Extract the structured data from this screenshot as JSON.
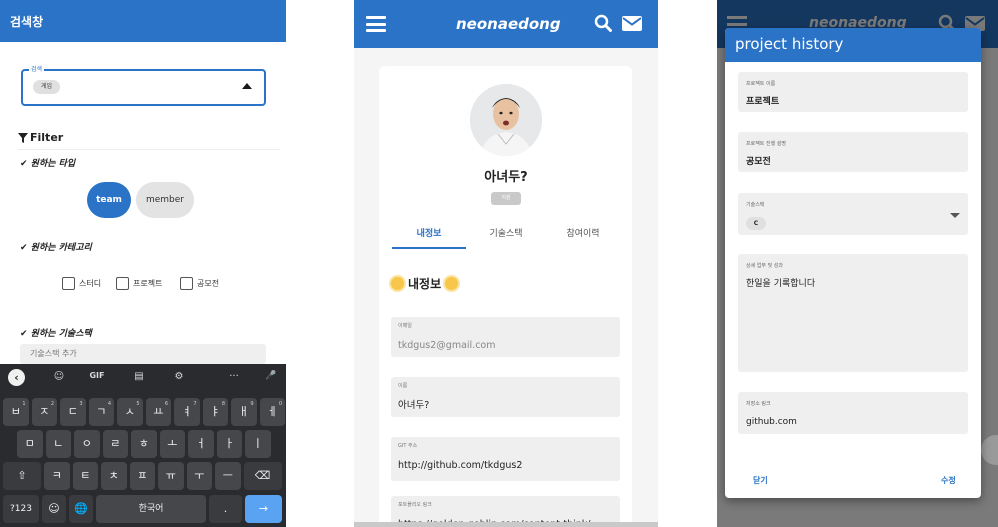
{
  "screen1": {
    "header_title": "검색창",
    "search_legend": "검색",
    "search_chip": "게임",
    "filter_label": "Filter",
    "type_label": "✔ 원하는 타입",
    "type_buttons": [
      "team",
      "member"
    ],
    "category_label": "✔ 원하는 카테고리",
    "categories": [
      "스터디",
      "프로젝트",
      "공모전"
    ],
    "stack_label": "✔ 원하는 기술스택",
    "stack_placeholder": "기술스택 추가",
    "keyboard": {
      "toolbar": [
        "☺",
        "GIF",
        "▤",
        "⚙",
        "···",
        "🎤"
      ],
      "row1": [
        {
          "k": "ㅂ",
          "n": "1"
        },
        {
          "k": "ㅈ",
          "n": "2"
        },
        {
          "k": "ㄷ",
          "n": "3"
        },
        {
          "k": "ㄱ",
          "n": "4"
        },
        {
          "k": "ㅅ",
          "n": "5"
        },
        {
          "k": "ㅛ",
          "n": "6"
        },
        {
          "k": "ㅕ",
          "n": "7"
        },
        {
          "k": "ㅑ",
          "n": "8"
        },
        {
          "k": "ㅐ",
          "n": "9"
        },
        {
          "k": "ㅔ",
          "n": "0"
        }
      ],
      "row2": [
        "ㅁ",
        "ㄴ",
        "ㅇ",
        "ㄹ",
        "ㅎ",
        "ㅗ",
        "ㅓ",
        "ㅏ",
        "ㅣ"
      ],
      "row3": [
        "⇧",
        "ㅋ",
        "ㅌ",
        "ㅊ",
        "ㅍ",
        "ㅠ",
        "ㅜ",
        "ㅡ",
        "⌫"
      ],
      "row4": [
        "?123",
        "☺",
        "🌐",
        "한국어",
        ".",
        "→"
      ]
    }
  },
  "screen2": {
    "app_title": "neonaedong",
    "user_name": "아녀두?",
    "badge": "지원",
    "tabs": [
      "내정보",
      "기술스택",
      "참여이력"
    ],
    "section_title": "내정보",
    "fields": [
      {
        "label": "이메일",
        "value": "tkdgus2@gmail.com",
        "muted": true
      },
      {
        "label": "이름",
        "value": "아녀두?"
      },
      {
        "label": "GIT 주소",
        "value": "http://github.com/tkdgus2"
      },
      {
        "label": "포트폴리오 링크",
        "value": "https://golden-goblin.com/content-think/"
      }
    ]
  },
  "screen3": {
    "app_title": "neonaedong",
    "dialog_title": "project history",
    "fields": [
      {
        "label": "프로젝트 이름",
        "value": "프로젝트"
      },
      {
        "label": "프로젝트 진행 설명",
        "value": "공모전"
      },
      {
        "label": "기술스택",
        "chip": "C"
      },
      {
        "label": "상세 업무 및 성과",
        "value": "한일을 기록합니다"
      },
      {
        "label": "저장소 링크",
        "value": "github.com"
      }
    ],
    "close_label": "닫기",
    "edit_label": "수정"
  }
}
